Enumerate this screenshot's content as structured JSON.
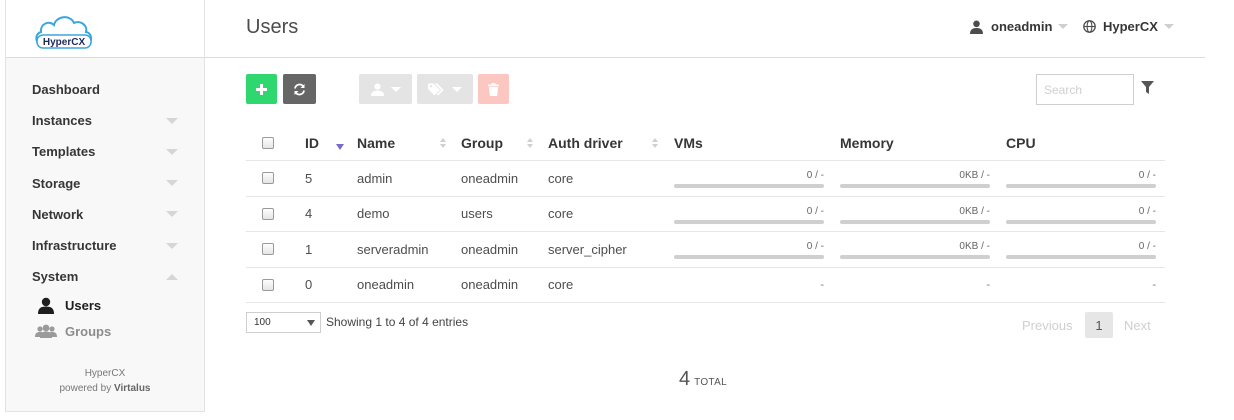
{
  "brand": {
    "logo_text": "HyperCX"
  },
  "header": {
    "title": "Users",
    "user": "oneadmin",
    "zone": "HyperCX"
  },
  "sidebar": {
    "items": [
      {
        "label": "Dashboard"
      },
      {
        "label": "Instances"
      },
      {
        "label": "Templates"
      },
      {
        "label": "Storage"
      },
      {
        "label": "Network"
      },
      {
        "label": "Infrastructure"
      },
      {
        "label": "System"
      }
    ],
    "subitems": [
      {
        "label": "Users"
      },
      {
        "label": "Groups"
      }
    ],
    "footer": {
      "product": "HyperCX",
      "powered_prefix": "powered by",
      "powered_name": "Virtalus"
    }
  },
  "toolbar": {
    "search_placeholder": "Search"
  },
  "table": {
    "columns": [
      "ID",
      "Name",
      "Group",
      "Auth driver",
      "VMs",
      "Memory",
      "CPU"
    ],
    "rows": [
      {
        "id": "5",
        "name": "admin",
        "group": "oneadmin",
        "auth": "core",
        "vms": "0 / -",
        "memory": "0KB / -",
        "cpu": "0 / -"
      },
      {
        "id": "4",
        "name": "demo",
        "group": "users",
        "auth": "core",
        "vms": "0 / -",
        "memory": "0KB / -",
        "cpu": "0 / -"
      },
      {
        "id": "1",
        "name": "serveradmin",
        "group": "oneadmin",
        "auth": "server_cipher",
        "vms": "0 / -",
        "memory": "0KB / -",
        "cpu": "0 / -"
      },
      {
        "id": "0",
        "name": "oneadmin",
        "group": "oneadmin",
        "auth": "core",
        "vms": "-",
        "memory": "-",
        "cpu": "-"
      }
    ]
  },
  "pagination": {
    "page_size": "100",
    "info": "Showing 1 to 4 of 4 entries",
    "previous": "Previous",
    "page": "1",
    "next": "Next"
  },
  "summary": {
    "total": "4",
    "total_label": "TOTAL"
  },
  "colors": {
    "create": "#2ed86e",
    "refresh": "#666666",
    "delete": "#fcc6c1",
    "sort_active": "#7c68c6"
  }
}
